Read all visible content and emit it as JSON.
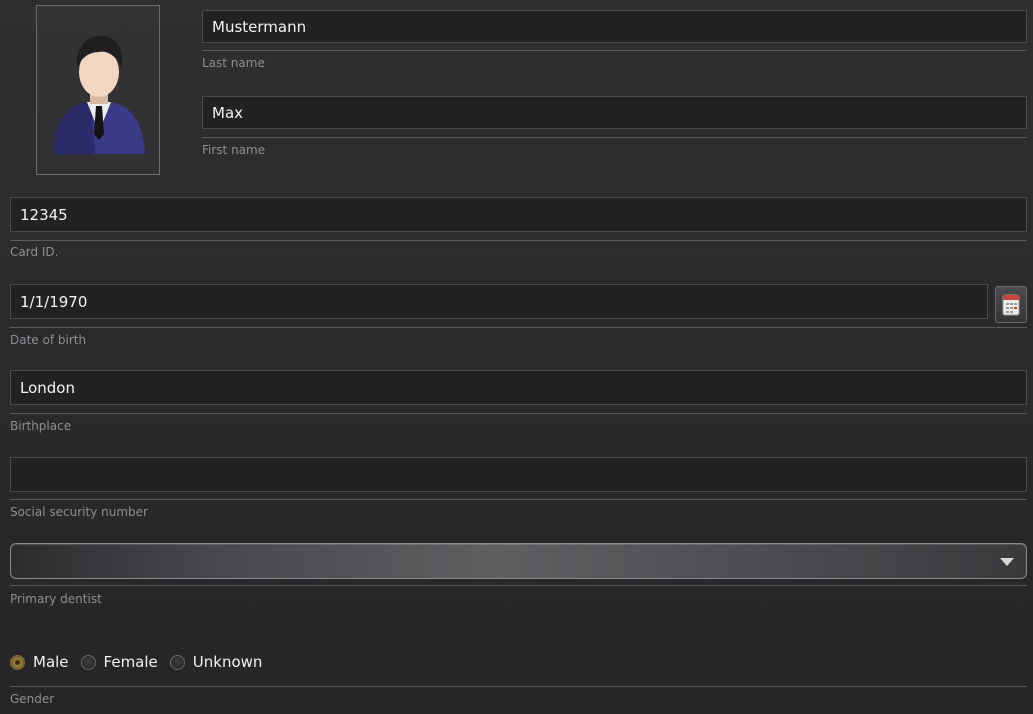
{
  "person": {
    "photo_icon": "person-in-suit-avatar-icon",
    "last_name": {
      "value": "Mustermann",
      "label": "Last name"
    },
    "first_name": {
      "value": "Max",
      "label": "First name"
    },
    "card_id": {
      "value": "12345",
      "label": "Card ID."
    },
    "date_of_birth": {
      "value": "1/1/1970",
      "label": "Date of birth",
      "calendar_icon": "calendar-icon"
    },
    "birthplace": {
      "value": "London",
      "label": "Birthplace"
    },
    "social_security_number": {
      "value": "",
      "label": "Social security number"
    },
    "primary_dentist": {
      "value": "",
      "label": "Primary dentist",
      "dropdown_icon": "chevron-down-icon"
    },
    "gender": {
      "label": "Gender",
      "options": [
        {
          "label": "Male",
          "selected": true
        },
        {
          "label": "Female",
          "selected": false
        },
        {
          "label": "Unknown",
          "selected": false
        }
      ]
    }
  },
  "colors": {
    "background": "#2b2b2d",
    "field_bg": "#222224",
    "label_text": "#8e8e92",
    "radio_selected": "#a0813e"
  }
}
